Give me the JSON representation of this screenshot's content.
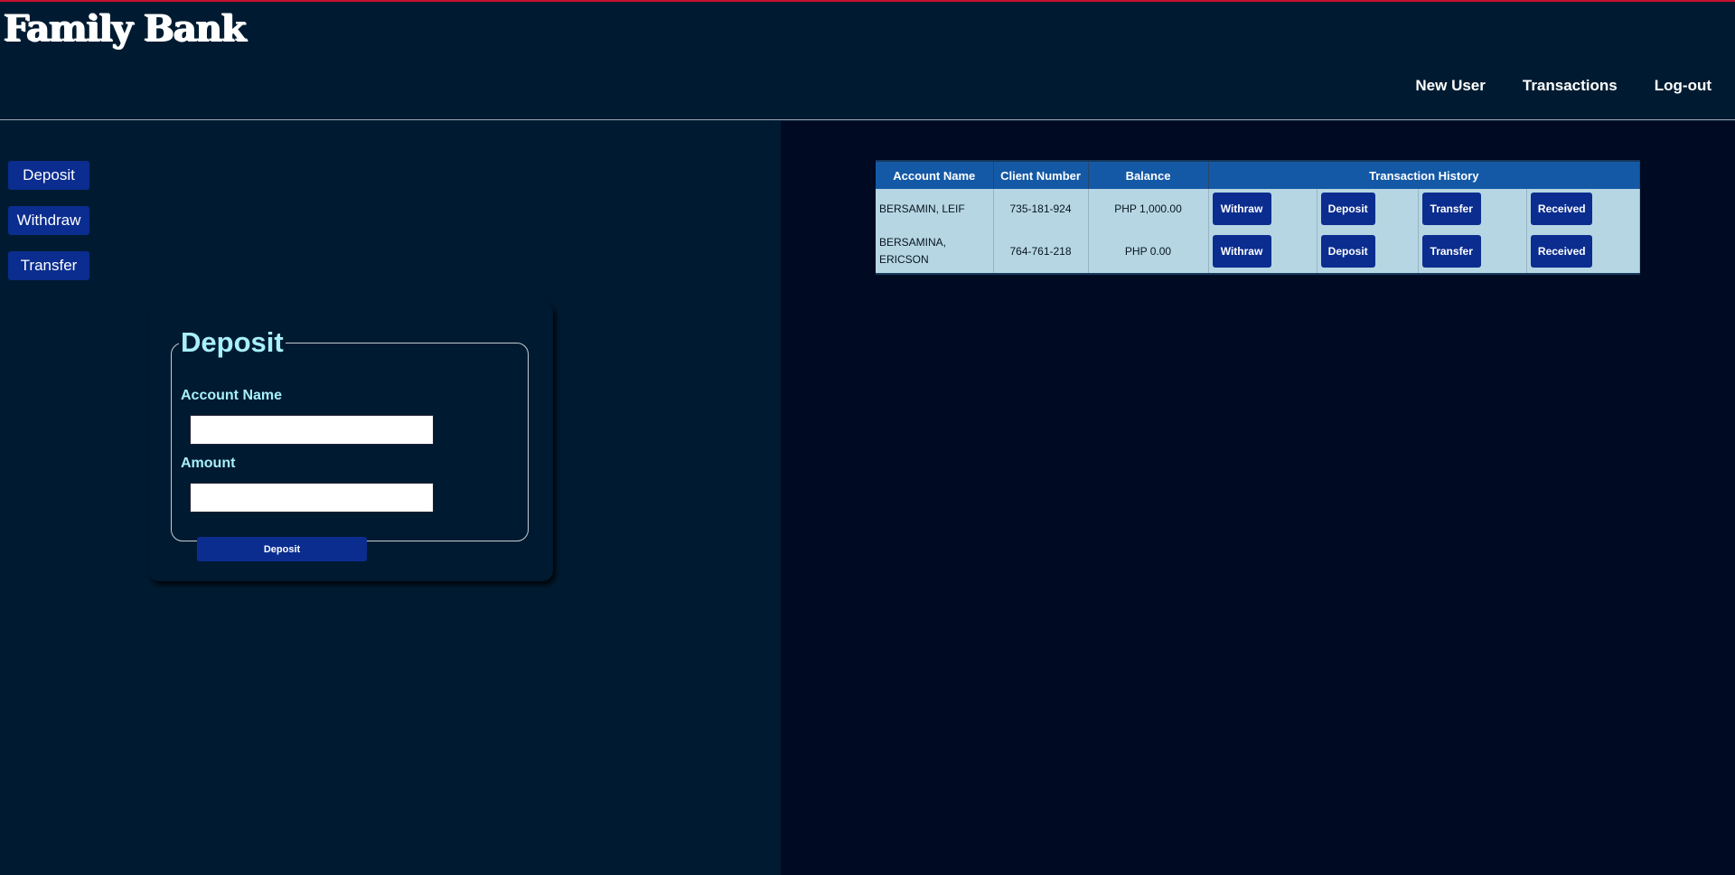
{
  "brand": {
    "title": "Family Bank"
  },
  "nav": {
    "new_user": "New User",
    "transactions": "Transactions",
    "logout": "Log-out"
  },
  "sidebar": {
    "deposit": "Deposit",
    "withdraw": "Withdraw",
    "transfer": "Transfer"
  },
  "form": {
    "legend": "Deposit",
    "account_name_label": "Account Name",
    "account_name_value": "",
    "amount_label": "Amount",
    "amount_value": "",
    "submit_label": "Deposit"
  },
  "table": {
    "headers": [
      "Account Name",
      "Client Number",
      "Balance",
      "Transaction History"
    ],
    "rows": [
      {
        "name": "BERSAMIN, LEIF",
        "client_number": "735-181-924",
        "balance": "PHP 1,000.00"
      },
      {
        "name": "BERSAMINA, ERICSON",
        "client_number": "764-761-218",
        "balance": "PHP 0.00"
      }
    ],
    "actions": {
      "withdraw": "Withraw",
      "deposit": "Deposit",
      "transfer": "Transfer",
      "received": "Received"
    }
  },
  "colors": {
    "background": "#001b31",
    "right_background": "#000b23",
    "button": "#0b2d8f",
    "table_header": "#1459a6",
    "table_row": "#b7d6e3",
    "accent_text": "#a8f0fb",
    "top_border": "#c8102e"
  }
}
